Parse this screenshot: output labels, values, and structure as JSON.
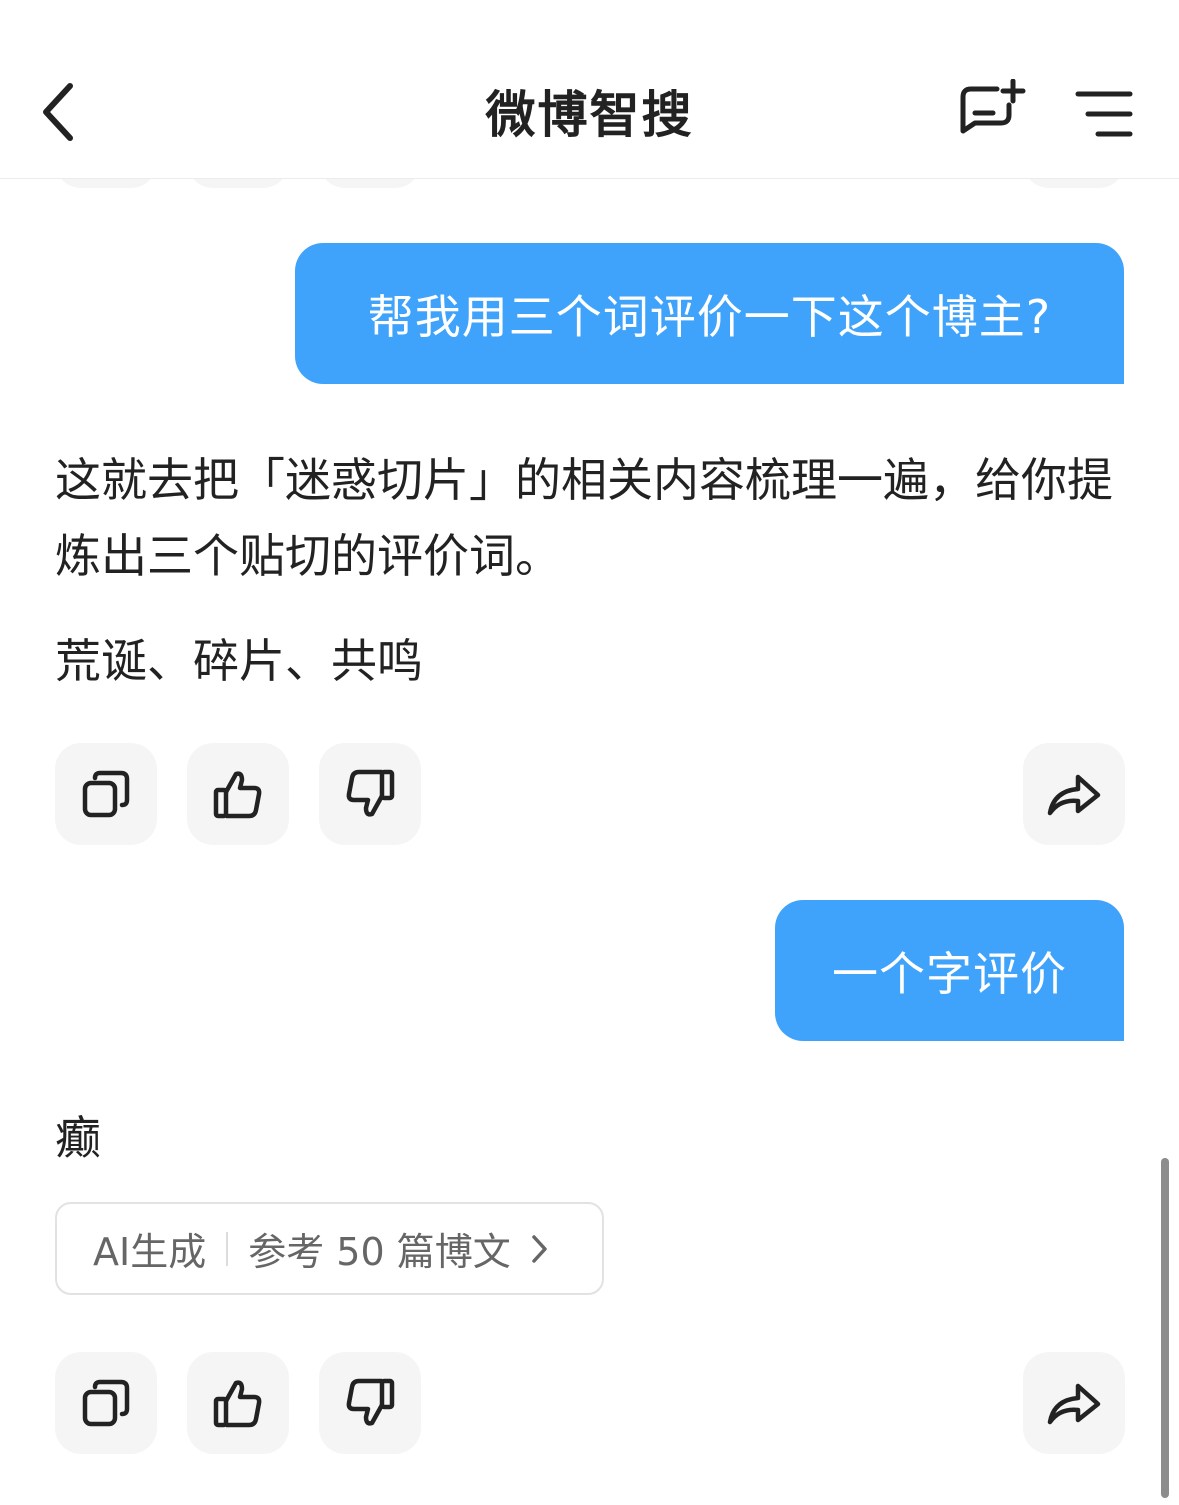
{
  "header": {
    "title": "微博智搜",
    "back_icon": "chevron-left-icon",
    "new_chat_icon": "chat-plus-icon",
    "menu_icon": "menu-lines-icon"
  },
  "conversation": {
    "user_message_1": "帮我用三个词评价一下这个博主?",
    "bot_reply_1_intro": "这就去把「迷惑切片」的相关内容梳理一遍，给你提炼出三个贴切的评价词。",
    "bot_reply_1_answer": "荒诞、碎片、共鸣",
    "user_message_2": "一个字评价",
    "bot_reply_2_answer": "癫",
    "source_chip": {
      "ai_label": "AI生成",
      "reference_label": "参考 50 篇博文"
    }
  },
  "actions": {
    "copy_icon": "copy-icon",
    "like_icon": "thumbs-up-icon",
    "dislike_icon": "thumbs-down-icon",
    "share_icon": "share-arrow-icon"
  },
  "colors": {
    "accent": "#3fa2fb",
    "action_bg": "#f5f5f5",
    "text": "#222222",
    "muted": "#666666"
  }
}
